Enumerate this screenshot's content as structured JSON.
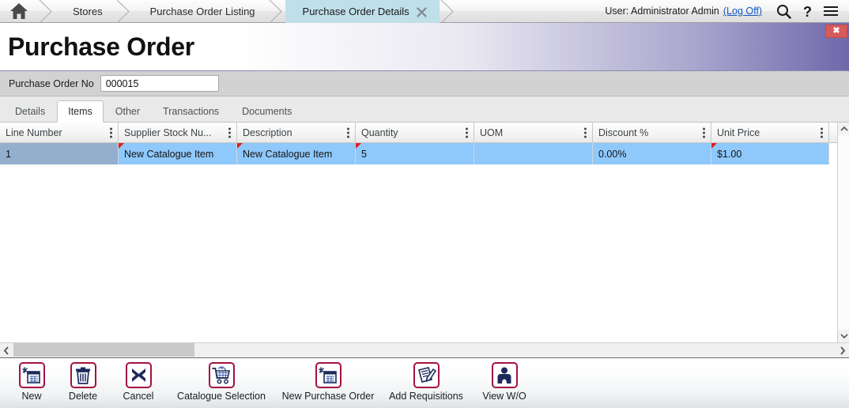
{
  "breadcrumb": {
    "home_icon": "home-icon",
    "items": [
      {
        "label": "Stores",
        "active": false
      },
      {
        "label": "Purchase Order Listing",
        "active": false
      },
      {
        "label": "Purchase Order Details",
        "active": true,
        "closable": true
      }
    ]
  },
  "header": {
    "user_text": "User: Administrator Admin",
    "logoff_label": "(Log Off)",
    "search_icon": "search-icon",
    "help_icon": "question-mark-icon",
    "menu_icon": "hamburger-menu-icon"
  },
  "title_band": {
    "title": "Purchase Order",
    "close_label": "✖",
    "gradient_end_color": "#6f68ab"
  },
  "po_field": {
    "label": "Purchase Order No",
    "value": "000015",
    "placeholder": ""
  },
  "tabs": [
    {
      "label": "Details",
      "active": false
    },
    {
      "label": "Items",
      "active": true
    },
    {
      "label": "Other",
      "active": false
    },
    {
      "label": "Transactions",
      "active": false
    },
    {
      "label": "Documents",
      "active": false
    }
  ],
  "grid": {
    "columns": [
      {
        "label": "Line Number",
        "width": 150
      },
      {
        "label": "Supplier Stock Nu...",
        "width": 150
      },
      {
        "label": "Description",
        "width": 150
      },
      {
        "label": "Quantity",
        "width": 150
      },
      {
        "label": "UOM",
        "width": 150
      },
      {
        "label": "Discount %",
        "width": 150
      },
      {
        "label": "Unit Price",
        "width": 149
      }
    ],
    "rows": [
      {
        "cells": [
          {
            "value": "1",
            "state": "selected",
            "marker": false
          },
          {
            "value": "New Catalogue Item",
            "state": "edit",
            "marker": true
          },
          {
            "value": "New Catalogue Item",
            "state": "edit",
            "marker": true
          },
          {
            "value": "5",
            "state": "edit",
            "marker": true
          },
          {
            "value": "",
            "state": "edit",
            "marker": false
          },
          {
            "value": "0.00%",
            "state": "edit",
            "marker": false
          },
          {
            "value": "$1.00",
            "state": "edit",
            "marker": true
          }
        ]
      }
    ],
    "selected_row_color": "#93afcd",
    "edit_cell_color": "#8fc8fb",
    "marker_color": "#e41b17"
  },
  "scrollbars": {
    "vertical_up_icon": "chevron-up-icon",
    "vertical_down_icon": "chevron-down-icon",
    "horizontal_left_icon": "chevron-left-icon",
    "horizontal_right_icon": "chevron-right-icon"
  },
  "toolbar": {
    "accent_color": "#a4123f",
    "buttons": [
      {
        "label": "New",
        "icon": "new-grid-sparkle-icon"
      },
      {
        "label": "Delete",
        "icon": "trash-can-icon"
      },
      {
        "label": "Cancel",
        "icon": "x-cross-icon"
      },
      {
        "label": "Catalogue Selection",
        "icon": "shopping-cart-icon"
      },
      {
        "label": "New Purchase Order",
        "icon": "new-grid-sparkle-icon"
      },
      {
        "label": "Add Requisitions",
        "icon": "document-pencil-icon"
      },
      {
        "label": "View W/O",
        "icon": "person-icon"
      }
    ]
  }
}
